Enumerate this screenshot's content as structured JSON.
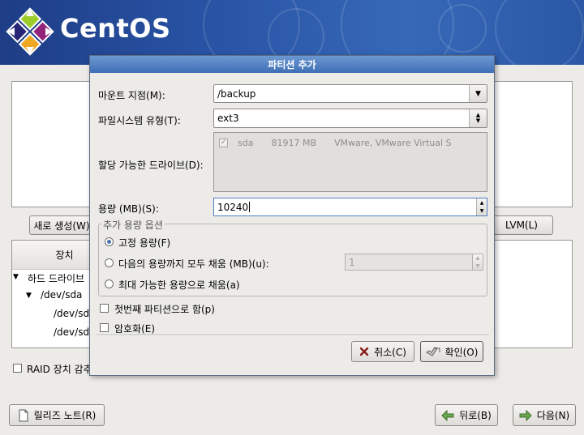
{
  "banner": {
    "brand": "CentOS"
  },
  "background": {
    "new_button": "새로 생성(W)",
    "lvm_button": "LVM(L)",
    "device_column_header": "장치",
    "tree": [
      "하드 드라이브",
      "/dev/sda",
      "/dev/sda",
      "/dev/sda"
    ],
    "raid_label": "RAID 장치 감추",
    "release_notes_button": "릴리즈 노트(R)",
    "back_button": "뒤로(B)",
    "next_button": "다음(N)"
  },
  "dialog": {
    "title": "파티션 추가",
    "mount_point_label": "마운트 지점(M):",
    "mount_point_value": "/backup",
    "fs_type_label": "파일시스템 유형(T):",
    "fs_type_value": "ext3",
    "drives_label": "할당 가능한 드라이브(D):",
    "drives": [
      {
        "checked": true,
        "name": "sda",
        "size": "81917 MB",
        "model": "VMware, VMware Virtual S"
      }
    ],
    "size_label": "용량 (MB)(S):",
    "size_value": "10240",
    "options_title": "추가 용량 옵션",
    "option_fixed": "고정 용량(F)",
    "option_fill_upto": "다음의 용량까지 모두 채움 (MB)(u):",
    "fill_upto_value": "1",
    "option_fill_max": "최대 가능한 용량으로 채움(a)",
    "selected_option": "fixed",
    "primary_label": "첫번째 파티션으로 함(p)",
    "encrypt_label": "암호화(E)",
    "cancel_button": "취소(C)",
    "ok_button": "확인(O)"
  },
  "colors": {
    "titlebar": "#4f7fc2",
    "banner": "#2a56a8",
    "radio_selected": "#4a6fa8"
  }
}
